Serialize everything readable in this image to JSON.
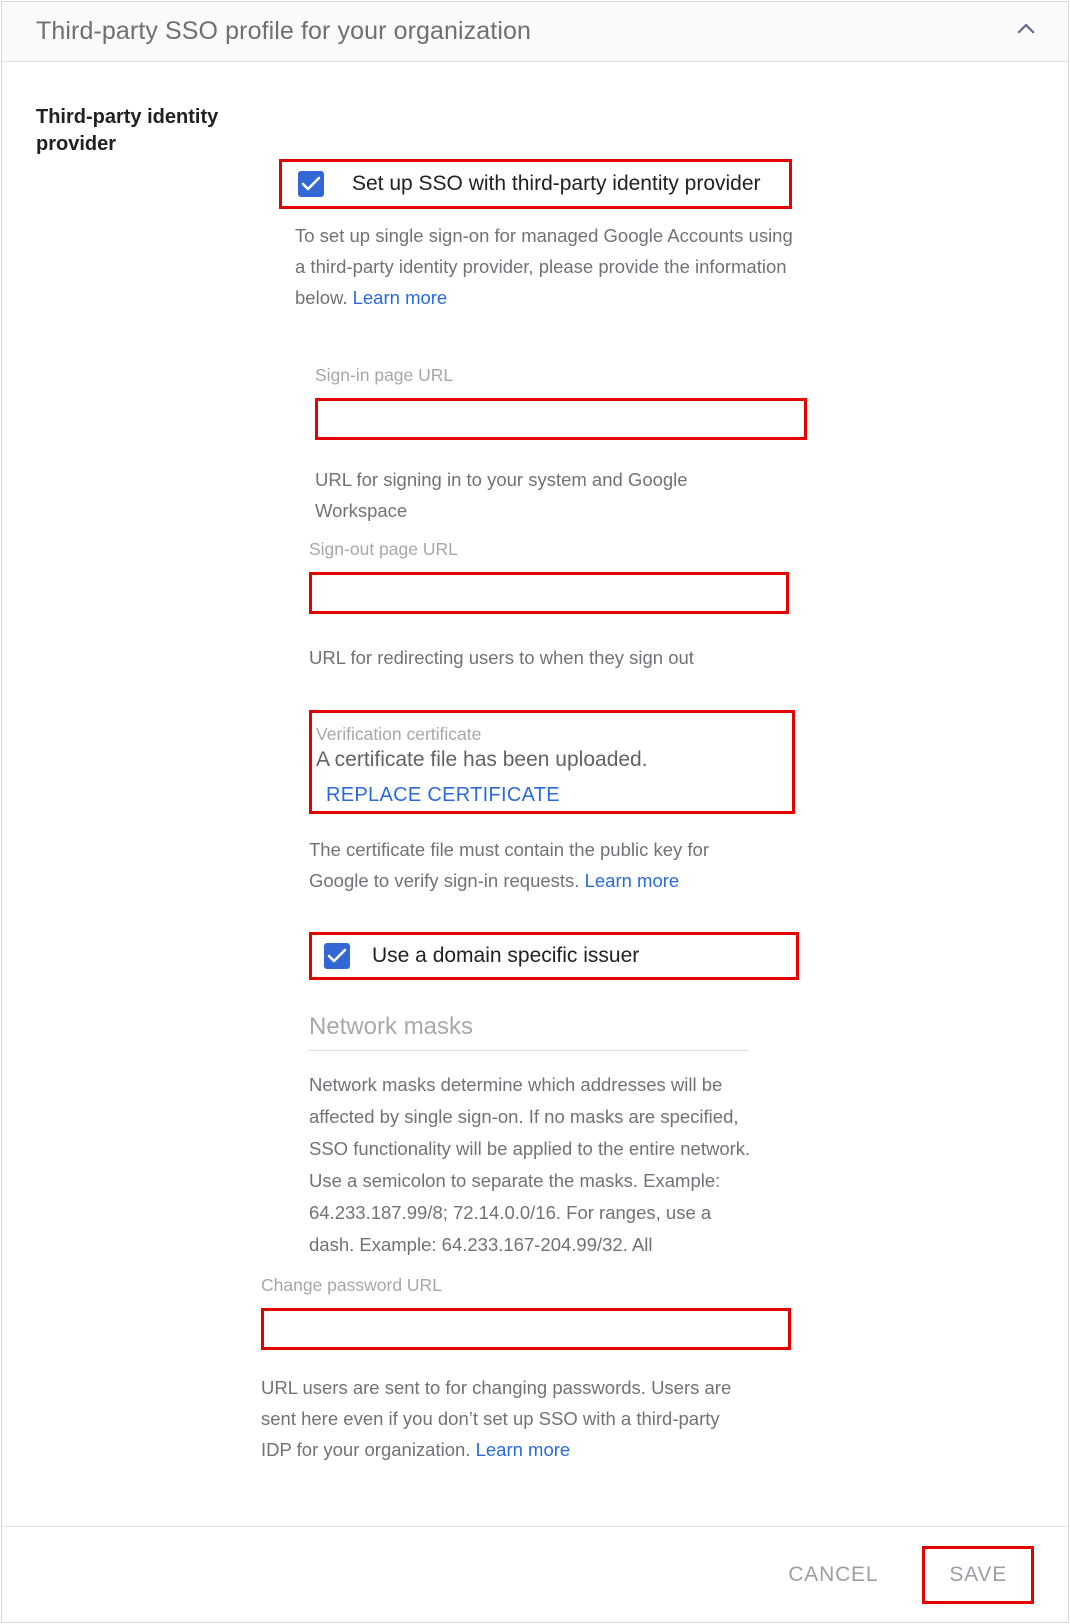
{
  "header": {
    "title": "Third-party SSO profile for your organization",
    "collapse_icon": "chevron-up-icon"
  },
  "section": {
    "left_label": "Third-party identity provider"
  },
  "sso_checkbox": {
    "label": "Set up SSO with third-party identity provider",
    "checked": true
  },
  "intro": {
    "text": "To set up single sign-on for managed Google Accounts using a third-party identity provider, please provide the information below. ",
    "link": "Learn more"
  },
  "signin_field": {
    "label": "Sign-in page URL",
    "value": "",
    "placeholder": "",
    "helper": "URL for signing in to your system and Google Workspace"
  },
  "signout_field": {
    "label": "Sign-out page URL",
    "value": "",
    "placeholder": "",
    "helper": "URL for redirecting users to when they sign out"
  },
  "certificate": {
    "label": "Verification certificate",
    "status": "A certificate file has been uploaded.",
    "action": "REPLACE CERTIFICATE",
    "helper": "The certificate file must contain the public key for Google to verify sign-in requests. ",
    "helper_link": "Learn more"
  },
  "issuer_checkbox": {
    "label": "Use a domain specific issuer",
    "checked": true
  },
  "network_masks": {
    "title": "Network masks",
    "description": "Network masks determine which addresses will be affected by single sign-on. If no masks are specified, SSO functionality will be applied to the entire network. Use a semicolon to separate the masks. Example: 64.233.187.99/8; 72.14.0.0/16. For ranges, use a dash. Example: 64.233.167-204.99/32. All"
  },
  "change_password_field": {
    "label": "Change password URL",
    "value": "",
    "placeholder": "",
    "helper": "URL users are sent to for changing passwords. Users are sent here even if you don’t set up SSO with a third-party IDP for your organization. ",
    "helper_link": "Learn more"
  },
  "footer": {
    "cancel_label": "CANCEL",
    "save_label": "SAVE"
  },
  "colors": {
    "highlight": "#e60000",
    "checkbox_blue": "#3367d6",
    "link_blue": "#2a6ae0",
    "muted_text": "#6f7377",
    "label_text": "#a5a8ab"
  }
}
